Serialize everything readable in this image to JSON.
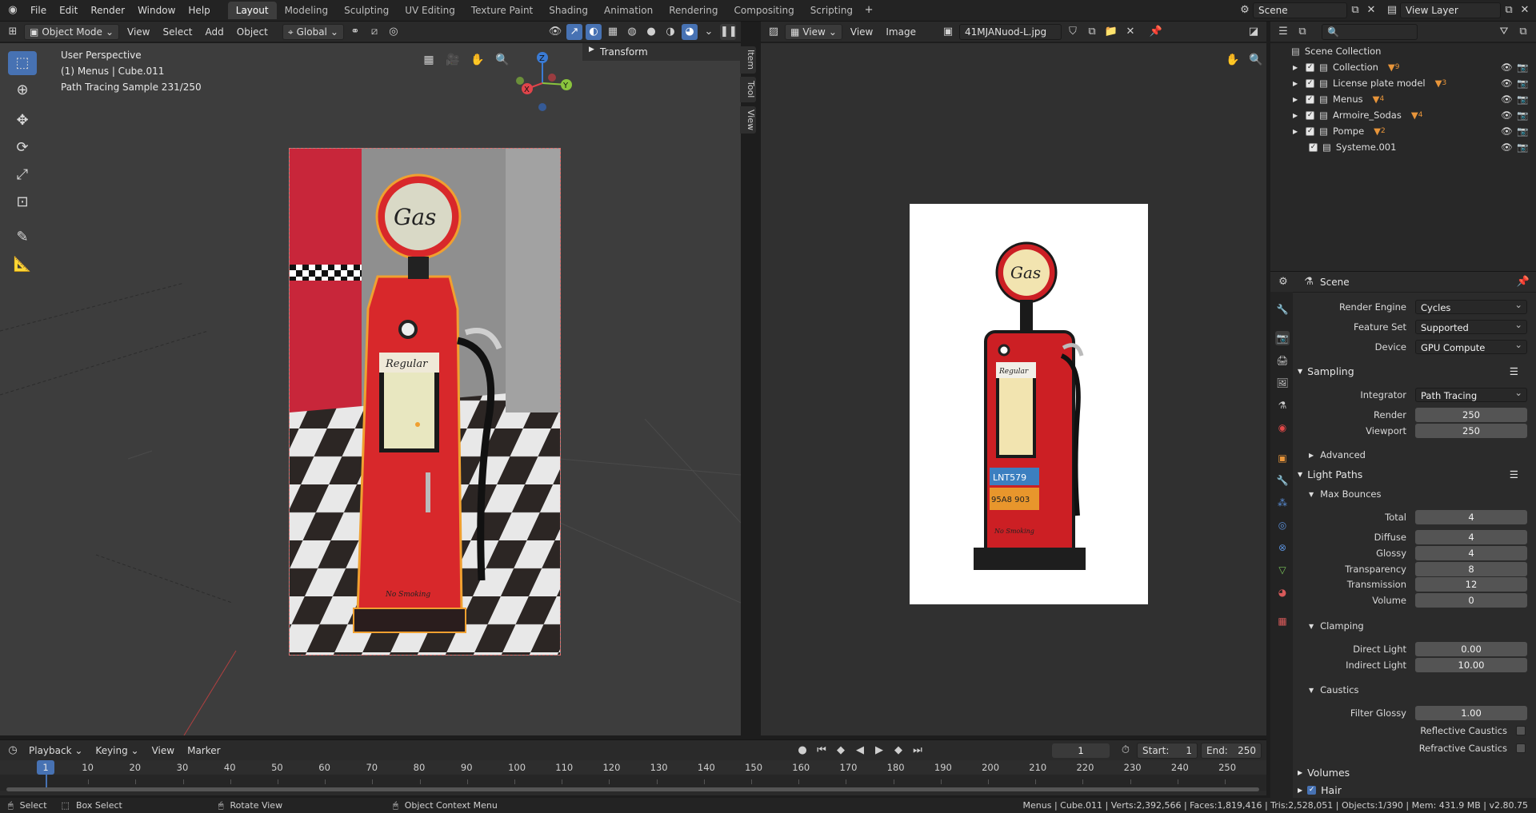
{
  "topbar": {
    "menus": [
      "File",
      "Edit",
      "Render",
      "Window",
      "Help"
    ],
    "workspaces": [
      "Layout",
      "Modeling",
      "Sculpting",
      "UV Editing",
      "Texture Paint",
      "Shading",
      "Animation",
      "Rendering",
      "Compositing",
      "Scripting"
    ],
    "active_workspace": "Layout",
    "scene": "Scene",
    "view_layer": "View Layer"
  },
  "viewport3d": {
    "mode": "Object Mode",
    "menus": [
      "View",
      "Select",
      "Add",
      "Object"
    ],
    "orientation": "Global",
    "overlay_lines": [
      "User Perspective",
      "(1) Menus | Cube.011",
      "Path Tracing Sample 231/250"
    ],
    "sidebar_panel": "Transform",
    "side_tabs": [
      "Item",
      "Tool",
      "View"
    ],
    "gizmo": {
      "x": "X",
      "y": "Y",
      "z": "Z"
    },
    "pump_labels": {
      "gas": "Gas",
      "regular": "Regular",
      "no_smoking": "No Smoking"
    }
  },
  "image_editor": {
    "view_label": "View",
    "menus": [
      "View",
      "Image"
    ],
    "image_name": "41MJANuod-L.jpg",
    "pump_labels": {
      "gas": "Gas",
      "regular": "Regular",
      "plate1": "LNT579",
      "plate2": "95A8 903",
      "no_smoking": "No Smoking"
    }
  },
  "outliner": {
    "root": "Scene Collection",
    "items": [
      "Collection",
      "License plate model",
      "Menus",
      "Armoire_Sodas",
      "Pompe",
      "Systeme.001"
    ],
    "badges": [
      "9",
      "3",
      "4",
      "4",
      "2"
    ]
  },
  "properties": {
    "context": "Scene",
    "render_engine": {
      "label": "Render Engine",
      "value": "Cycles"
    },
    "feature_set": {
      "label": "Feature Set",
      "value": "Supported"
    },
    "device": {
      "label": "Device",
      "value": "GPU Compute"
    },
    "sampling": {
      "title": "Sampling",
      "integrator_label": "Integrator",
      "integrator": "Path Tracing",
      "render_label": "Render",
      "render": "250",
      "viewport_label": "Viewport",
      "viewport": "250",
      "advanced": "Advanced"
    },
    "light_paths": {
      "title": "Light Paths",
      "max_bounces": "Max Bounces",
      "rows": [
        {
          "label": "Total",
          "value": "4"
        },
        {
          "label": "Diffuse",
          "value": "4"
        },
        {
          "label": "Glossy",
          "value": "4"
        },
        {
          "label": "Transparency",
          "value": "8"
        },
        {
          "label": "Transmission",
          "value": "12"
        },
        {
          "label": "Volume",
          "value": "0"
        }
      ]
    },
    "clamping": {
      "title": "Clamping",
      "direct_label": "Direct Light",
      "direct": "0.00",
      "indirect_label": "Indirect Light",
      "indirect": "10.00"
    },
    "caustics": {
      "title": "Caustics",
      "filter_label": "Filter Glossy",
      "filter": "1.00",
      "reflective": "Reflective Caustics",
      "refractive": "Refractive Caustics"
    },
    "volumes": "Volumes",
    "hair": "Hair"
  },
  "timeline": {
    "menus": [
      "Playback",
      "Keying",
      "View",
      "Marker"
    ],
    "current_frame": "1",
    "start_label": "Start:",
    "start": "1",
    "end_label": "End:",
    "end": "250",
    "ticks": [
      "1",
      "10",
      "20",
      "30",
      "40",
      "50",
      "60",
      "70",
      "80",
      "90",
      "100",
      "110",
      "120",
      "130",
      "140",
      "150",
      "160",
      "170",
      "180",
      "190",
      "200",
      "210",
      "220",
      "230",
      "240",
      "250"
    ]
  },
  "statusbar": {
    "select": "Select",
    "box_select": "Box Select",
    "rotate_view": "Rotate View",
    "context_menu": "Object Context Menu",
    "stats": "Menus | Cube.011 | Verts:2,392,566 | Faces:1,819,416 | Tris:2,528,051 | Objects:1/390 | Mem: 431.9 MB | v2.80.75"
  },
  "colors": {
    "accent": "#4772b3",
    "pump_red": "#d8282b",
    "selection": "#f0a030"
  }
}
